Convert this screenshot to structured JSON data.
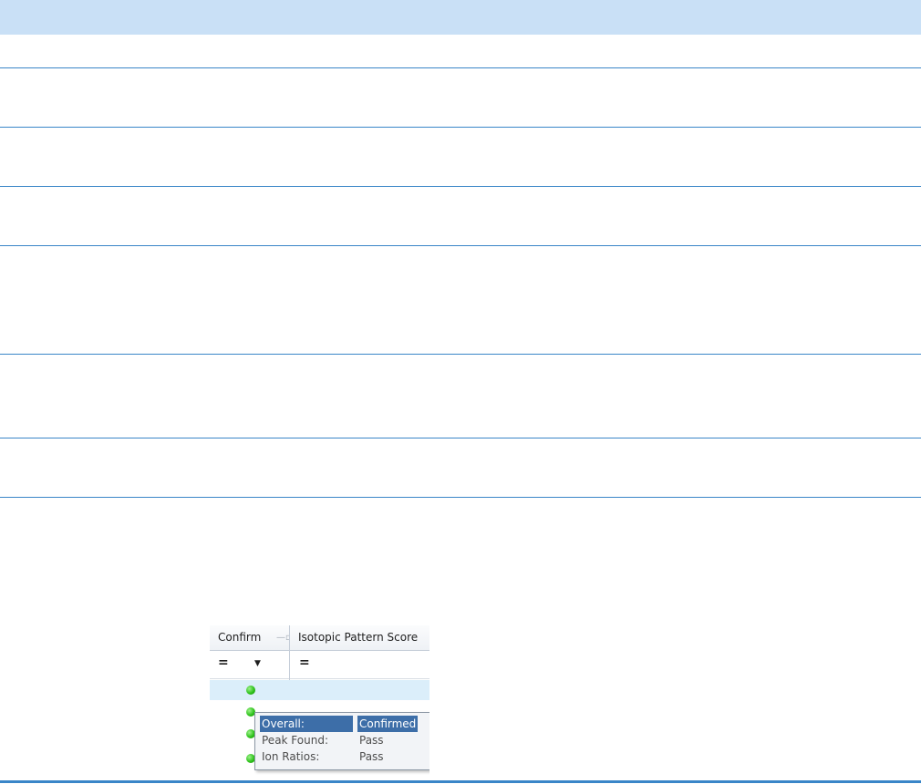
{
  "grid": {
    "columns": [
      {
        "label": "Confirm"
      },
      {
        "label": "Isotopic Pattern Score"
      }
    ],
    "filter": {
      "confirm_operator": "=",
      "isotopic_operator": "="
    },
    "status_icon": "green-dot-icon"
  },
  "tooltip": {
    "rows": [
      {
        "label": "Overall:",
        "value": "Confirmed"
      },
      {
        "label": "Peak Found:",
        "value": "Pass"
      },
      {
        "label": "Ion Ratios:",
        "value": "Pass"
      }
    ]
  },
  "colors": {
    "header_band": "#c9e0f6",
    "rule": "#3a86c8",
    "selected_row": "#dbeefa",
    "status_ok": "#2ec21b",
    "highlight": "#3d6ea8"
  }
}
